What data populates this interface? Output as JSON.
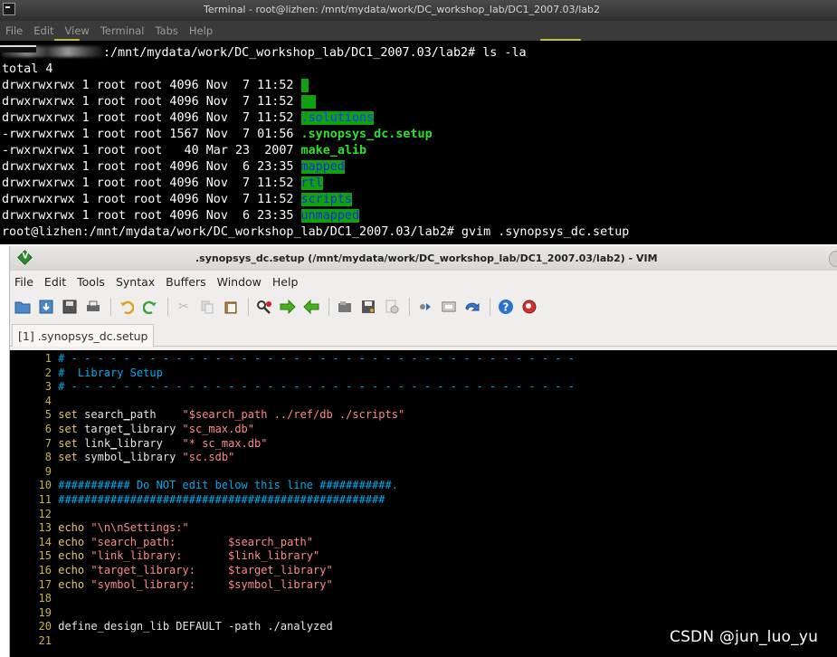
{
  "terminal": {
    "title": "Terminal - root@lizhen: /mnt/mydata/work/DC_workshop_lab/DC1_2007.03/lab2",
    "menu": [
      "File",
      "Edit",
      "View",
      "Terminal",
      "Tabs",
      "Help"
    ],
    "prompt_suffix_first": ":/mnt/mydata/work/DC_workshop_lab/DC1_2007.03/lab2# ",
    "command_first": "ls -la",
    "total": "total 4",
    "listing": [
      {
        "meta": "drwxrwxrwx 1 root root 4096 Nov  7 11:52 ",
        "name": ".",
        "style": "dot"
      },
      {
        "meta": "drwxrwxrwx 1 root root 4096 Nov  7 11:52 ",
        "name": "..",
        "style": "dot"
      },
      {
        "meta": "drwxrwxrwx 1 root root 4096 Nov  7 11:52 ",
        "name": ".solutions",
        "style": "dir"
      },
      {
        "meta": "-rwxrwxrwx 1 root root 1567 Nov  7 01:56 ",
        "name": ".synopsys_dc.setup",
        "style": "exec"
      },
      {
        "meta": "-rwxrwxrwx 1 root root   40 Mar 23  2007 ",
        "name": "make_alib",
        "style": "exec"
      },
      {
        "meta": "drwxrwxrwx 1 root root 4096 Nov  6 23:35 ",
        "name": "mapped",
        "style": "dir"
      },
      {
        "meta": "drwxrwxrwx 1 root root 4096 Nov  7 11:52 ",
        "name": "rtl",
        "style": "dir"
      },
      {
        "meta": "drwxrwxrwx 1 root root 4096 Nov  7 11:52 ",
        "name": "scripts",
        "style": "dir"
      },
      {
        "meta": "drwxrwxrwx 1 root root 4096 Nov  6 23:35 ",
        "name": "unmapped",
        "style": "dir"
      }
    ],
    "prompt_second": "root@lizhen:/mnt/mydata/work/DC_workshop_lab/DC1_2007.03/lab2# ",
    "command_second": "gvim .synopsys_dc.setup"
  },
  "vim": {
    "title": ".synopsys_dc.setup (/mnt/mydata/work/DC_workshop_lab/DC1_2007.03/lab2) - VIM",
    "menu": [
      "File",
      "Edit",
      "Tools",
      "Syntax",
      "Buffers",
      "Window",
      "Help"
    ],
    "tab_label": "[1] .synopsys_dc.setup",
    "toolbar_icons": [
      "open-folder-icon",
      "save-down-icon",
      "save-icon",
      "print-icon",
      "undo-icon",
      "redo-icon",
      "cut-icon",
      "copy-icon",
      "paste-icon",
      "find-replace-icon",
      "find-next-icon",
      "find-prev-icon",
      "load-session-icon",
      "save-session-icon",
      "run-script-icon",
      "make-icon",
      "shell-icon",
      "tag-jump-icon",
      "help-icon",
      "help-search-icon"
    ],
    "code_lines": [
      {
        "n": "1",
        "segs": [
          {
            "c": "cmt",
            "t": "# - - - - - - - - - - - - - - - - - - - - - - - - - - - - - - - - - - - - - - -"
          }
        ]
      },
      {
        "n": "2",
        "segs": [
          {
            "c": "cmt",
            "t": "#  Library Setup"
          }
        ]
      },
      {
        "n": "3",
        "segs": [
          {
            "c": "cmt",
            "t": "# - - - - - - - - - - - - - - - - - - - - - - - - - - - - - - - - - - - - - - -"
          }
        ]
      },
      {
        "n": "4",
        "segs": []
      },
      {
        "n": "5",
        "segs": [
          {
            "c": "kw",
            "t": "set"
          },
          {
            "c": "plain",
            "t": " search"
          },
          {
            "c": "und",
            "t": "_"
          },
          {
            "c": "plain",
            "t": "path    "
          },
          {
            "c": "str",
            "t": "\"$search_path ../ref/db ./scripts\""
          }
        ]
      },
      {
        "n": "6",
        "segs": [
          {
            "c": "kw",
            "t": "set"
          },
          {
            "c": "plain",
            "t": " target"
          },
          {
            "c": "und",
            "t": "_"
          },
          {
            "c": "plain",
            "t": "library "
          },
          {
            "c": "str",
            "t": "\"sc_max.db\""
          }
        ]
      },
      {
        "n": "7",
        "segs": [
          {
            "c": "kw",
            "t": "set"
          },
          {
            "c": "plain",
            "t": " link"
          },
          {
            "c": "und",
            "t": "_"
          },
          {
            "c": "plain",
            "t": "library   "
          },
          {
            "c": "str",
            "t": "\"* sc_max.db\""
          }
        ]
      },
      {
        "n": "8",
        "segs": [
          {
            "c": "kw",
            "t": "set"
          },
          {
            "c": "plain",
            "t": " symbol"
          },
          {
            "c": "und",
            "t": "_"
          },
          {
            "c": "plain",
            "t": "library "
          },
          {
            "c": "str",
            "t": "\"sc.sdb\""
          }
        ]
      },
      {
        "n": "9",
        "segs": []
      },
      {
        "n": "10",
        "segs": [
          {
            "c": "cmt",
            "t": "########### Do NOT edit below this line ###########."
          }
        ]
      },
      {
        "n": "11",
        "segs": [
          {
            "c": "cmt",
            "t": "##################################################"
          }
        ]
      },
      {
        "n": "12",
        "segs": []
      },
      {
        "n": "13",
        "segs": [
          {
            "c": "kw",
            "t": "echo"
          },
          {
            "c": "str",
            "t": " \"\\n\\nSettings:\""
          }
        ]
      },
      {
        "n": "14",
        "segs": [
          {
            "c": "kw",
            "t": "echo"
          },
          {
            "c": "str",
            "t": " \"search_path:        $search_path\""
          }
        ]
      },
      {
        "n": "15",
        "segs": [
          {
            "c": "kw",
            "t": "echo"
          },
          {
            "c": "str",
            "t": " \"link_library:       $link_library\""
          }
        ]
      },
      {
        "n": "16",
        "segs": [
          {
            "c": "kw",
            "t": "echo"
          },
          {
            "c": "str",
            "t": " \"target_library:     $target_library\""
          }
        ]
      },
      {
        "n": "17",
        "segs": [
          {
            "c": "kw",
            "t": "echo"
          },
          {
            "c": "str",
            "t": " \"symbol_library:     $symbol_library\""
          }
        ]
      },
      {
        "n": "18",
        "segs": []
      },
      {
        "n": "19",
        "segs": []
      },
      {
        "n": "20",
        "segs": [
          {
            "c": "plain",
            "t": "define_design_lib DEFAULT -path ./analyzed"
          }
        ]
      },
      {
        "n": "21",
        "segs": []
      }
    ]
  },
  "watermark": "CSDN @jun_luo_yu",
  "colors": {
    "terminal_bg": "#000000",
    "dir_highlight_bg": "#0fa10f",
    "dir_text": "#1a2bd8",
    "exec_text": "#2fe02f",
    "vim_comment": "#00aaee",
    "vim_keyword": "#e8c270",
    "vim_string": "#ff8a8a",
    "vim_line_number": "#c8b24a"
  }
}
